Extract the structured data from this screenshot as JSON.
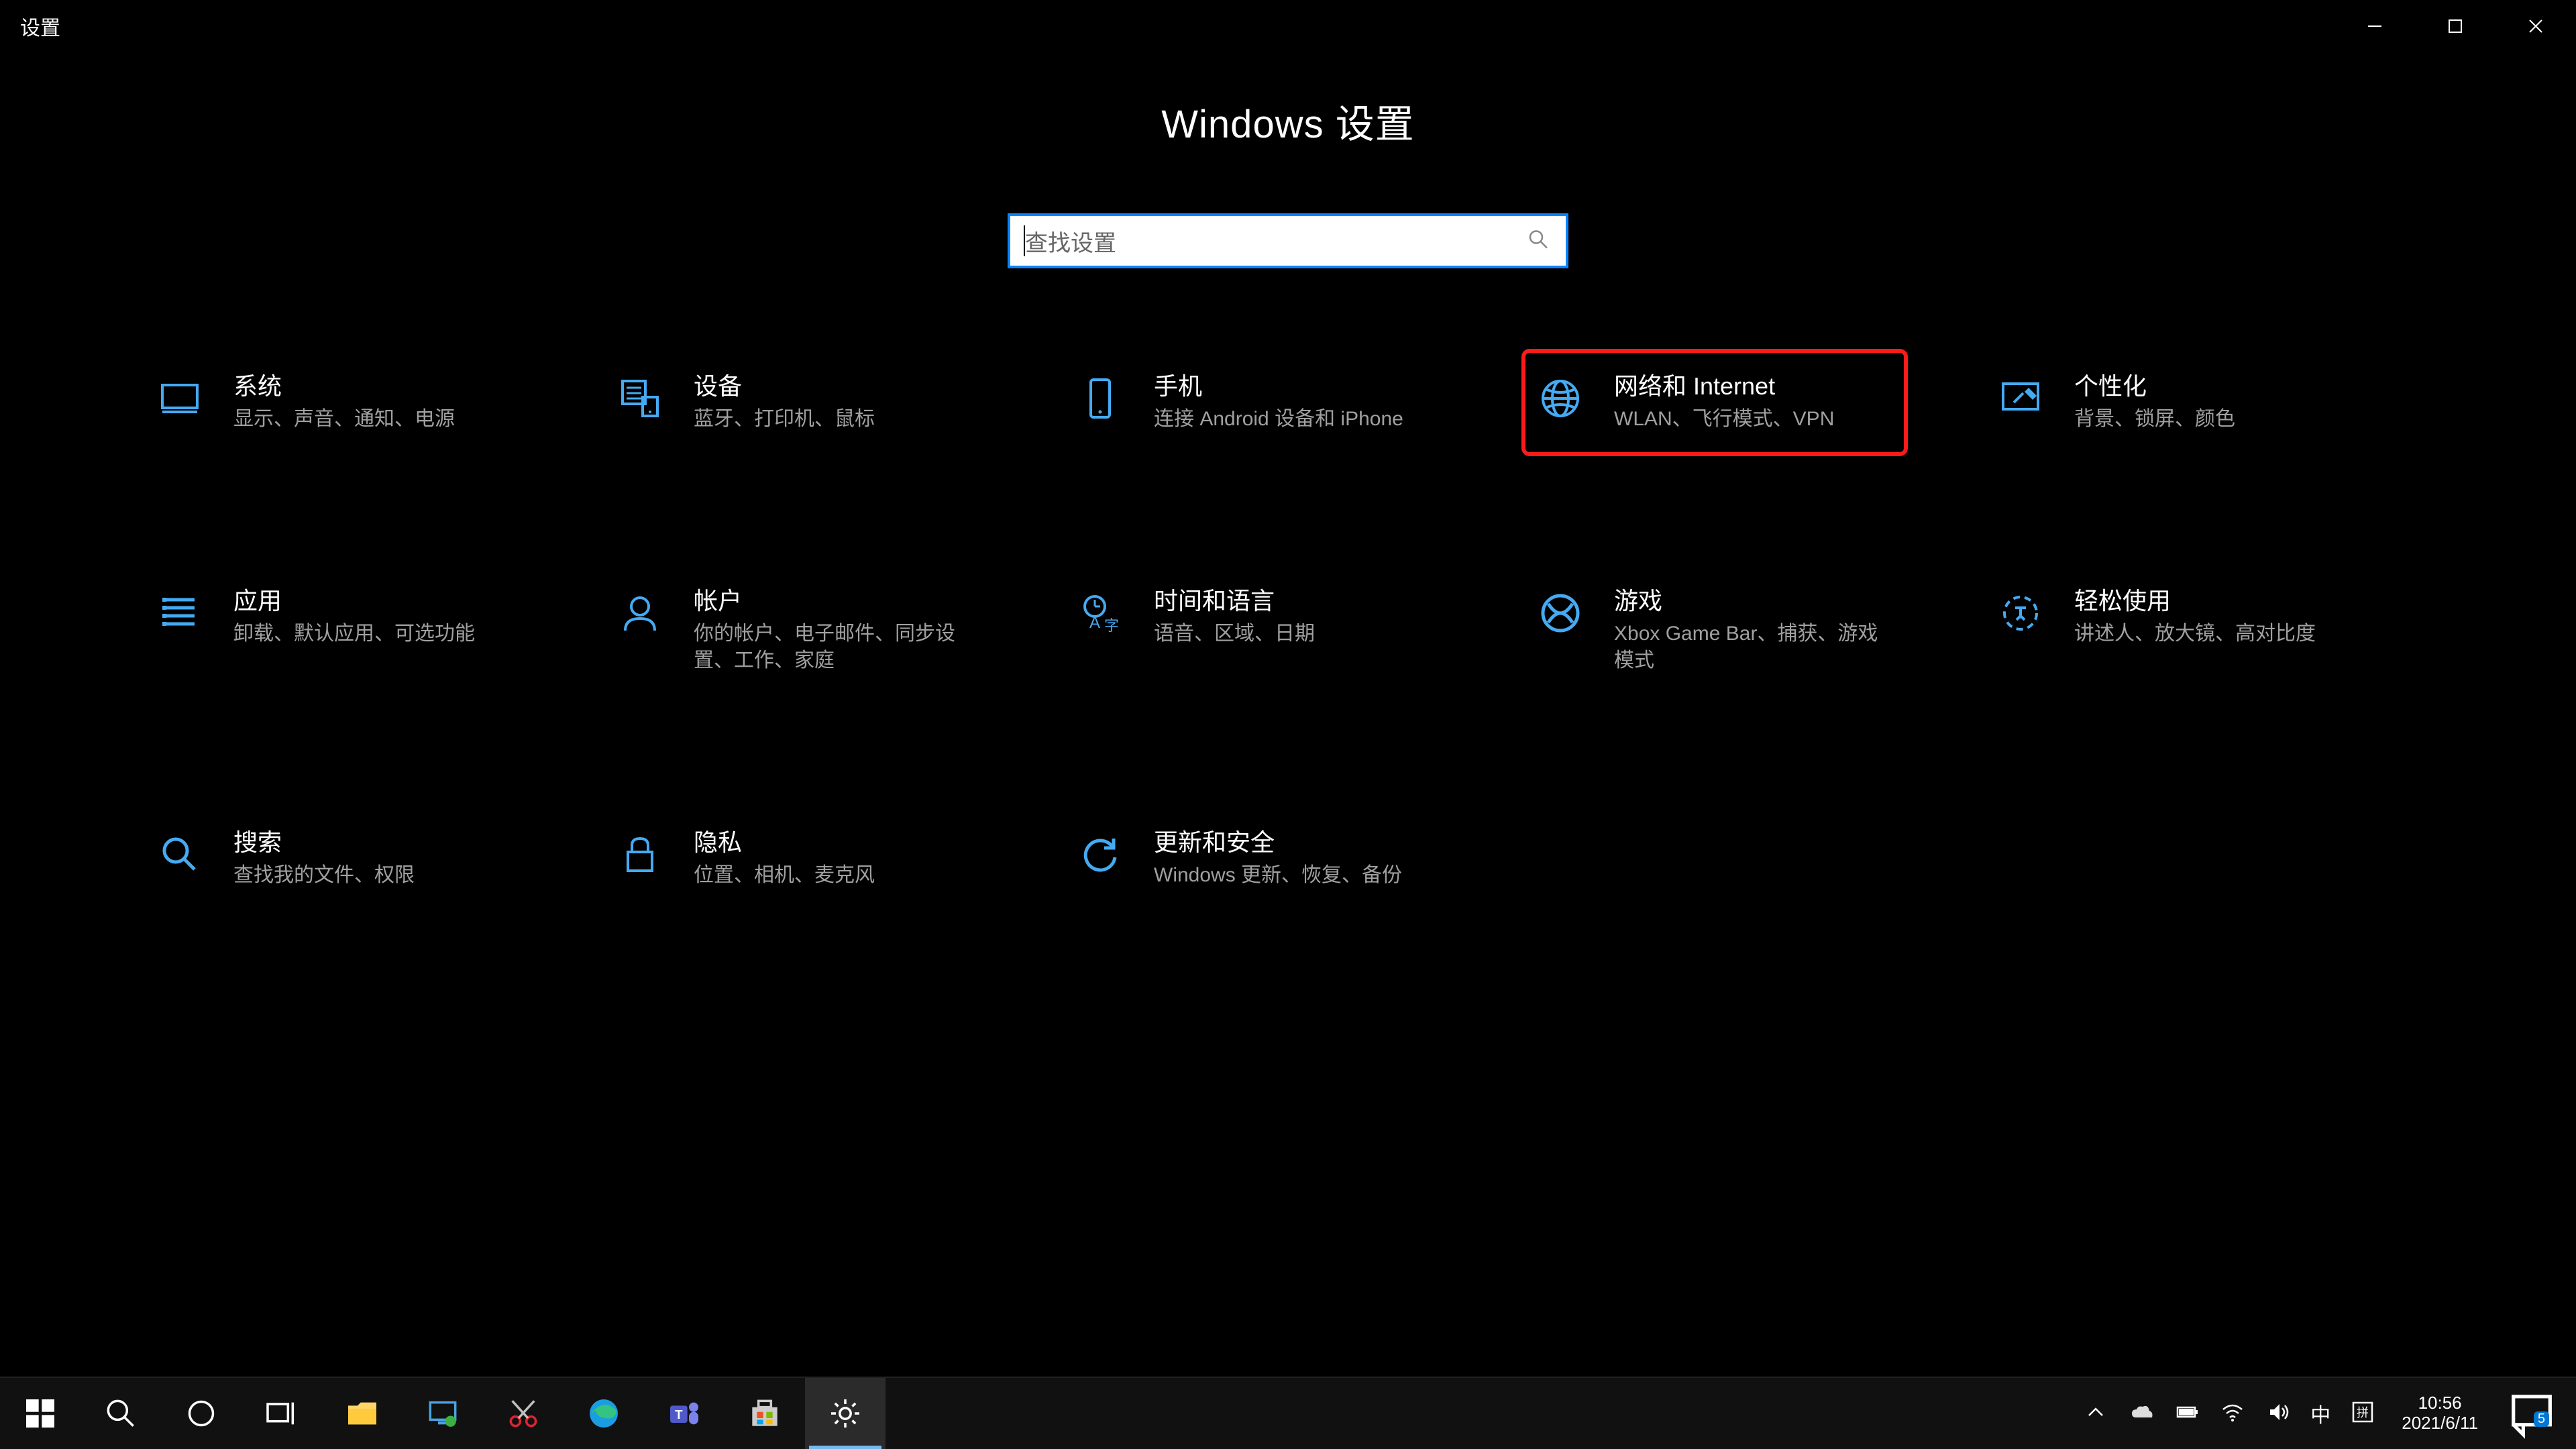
{
  "window": {
    "title": "设置"
  },
  "header": {
    "page_title": "Windows 设置"
  },
  "search": {
    "placeholder": "查找设置"
  },
  "categories": [
    {
      "id": "system",
      "title": "系统",
      "desc": "显示、声音、通知、电源",
      "highlight": false
    },
    {
      "id": "devices",
      "title": "设备",
      "desc": "蓝牙、打印机、鼠标",
      "highlight": false
    },
    {
      "id": "phone",
      "title": "手机",
      "desc": "连接 Android 设备和 iPhone",
      "highlight": false
    },
    {
      "id": "network",
      "title": "网络和 Internet",
      "desc": "WLAN、飞行模式、VPN",
      "highlight": true
    },
    {
      "id": "personalize",
      "title": "个性化",
      "desc": "背景、锁屏、颜色",
      "highlight": false
    },
    {
      "id": "apps",
      "title": "应用",
      "desc": "卸载、默认应用、可选功能",
      "highlight": false
    },
    {
      "id": "accounts",
      "title": "帐户",
      "desc": "你的帐户、电子邮件、同步设置、工作、家庭",
      "highlight": false
    },
    {
      "id": "time",
      "title": "时间和语言",
      "desc": "语音、区域、日期",
      "highlight": false
    },
    {
      "id": "gaming",
      "title": "游戏",
      "desc": "Xbox Game Bar、捕获、游戏模式",
      "highlight": false
    },
    {
      "id": "ease",
      "title": "轻松使用",
      "desc": "讲述人、放大镜、高对比度",
      "highlight": false
    },
    {
      "id": "search",
      "title": "搜索",
      "desc": "查找我的文件、权限",
      "highlight": false
    },
    {
      "id": "privacy",
      "title": "隐私",
      "desc": "位置、相机、麦克风",
      "highlight": false
    },
    {
      "id": "update",
      "title": "更新和安全",
      "desc": "Windows 更新、恢复、备份",
      "highlight": false
    }
  ],
  "taskbar": {
    "ime_lang": "中",
    "ime_mode": "拼",
    "time": "10:56",
    "date": "2021/6/11",
    "notif_count": "5"
  }
}
